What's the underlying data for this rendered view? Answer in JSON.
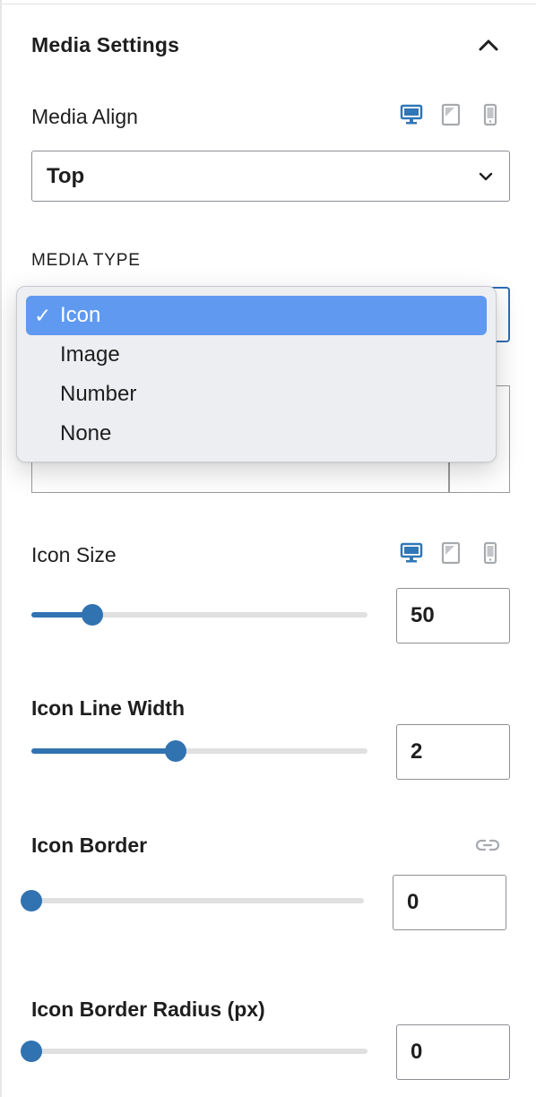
{
  "panel": {
    "title": "Media Settings"
  },
  "media_align": {
    "label": "Media Align",
    "value": "Top"
  },
  "media_type": {
    "label": "MEDIA TYPE",
    "options": [
      {
        "label": "Icon",
        "selected": true
      },
      {
        "label": "Image",
        "selected": false
      },
      {
        "label": "Number",
        "selected": false
      },
      {
        "label": "None",
        "selected": false
      }
    ],
    "check": "✓"
  },
  "icon_size": {
    "label": "Icon Size",
    "value": "50",
    "fraction": 0.18
  },
  "icon_line_width": {
    "label": "Icon Line Width",
    "value": "2",
    "fraction": 0.43
  },
  "icon_border": {
    "label": "Icon Border",
    "value": "0",
    "fraction": 0.0
  },
  "icon_border_radius": {
    "label": "Icon Border Radius (px)",
    "value": "0",
    "fraction": 0.0
  },
  "colors": {
    "accent": "#3172b1",
    "device_active": "#2f77b8",
    "device_inactive": "#a7aaad",
    "dropdown_selected": "#5f9af0"
  },
  "icons": [
    "chevron-up-icon",
    "desktop-icon",
    "tablet-icon",
    "mobile-icon",
    "chevron-down-icon",
    "checkmark-icon",
    "link-icon"
  ]
}
